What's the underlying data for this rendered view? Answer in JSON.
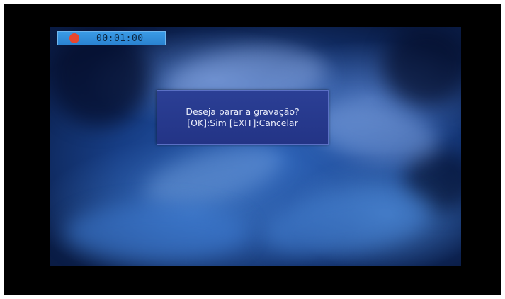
{
  "recording": {
    "indicator_icon": "record-dot-icon",
    "indicator_color": "#e8472e",
    "elapsed_time": "00:01:00"
  },
  "dialog": {
    "question": "Deseja parar a gravação?",
    "options": "[OK]:Sim [EXIT]:Cancelar"
  },
  "colors": {
    "frame": "#000000",
    "rec_bar": "#2a82d0",
    "dialog_bg": "#263a8e",
    "dialog_text": "#e8ecfa"
  }
}
